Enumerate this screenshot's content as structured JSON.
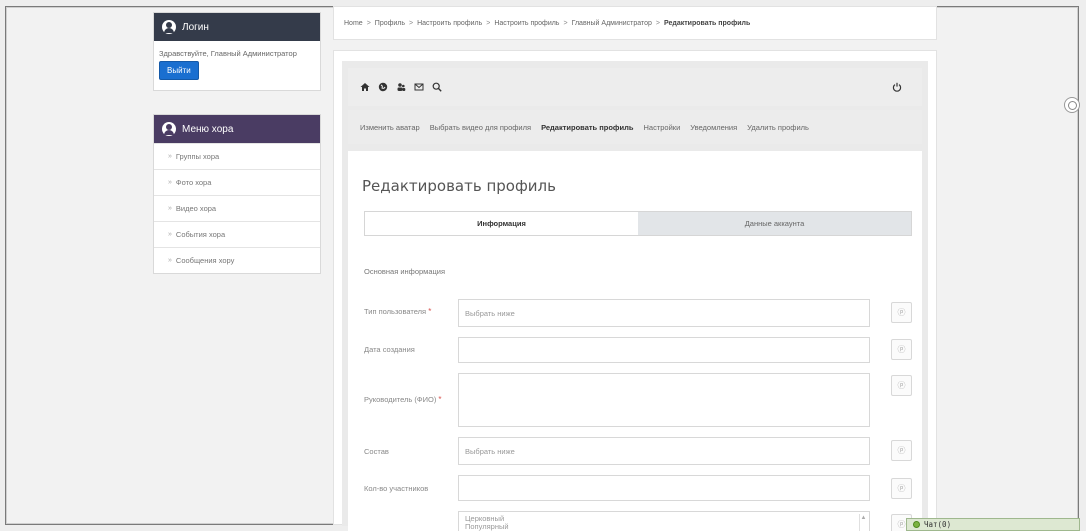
{
  "login_panel": {
    "title": "Логин",
    "greeting": "Здравствуйте, Главный Администратор",
    "logout_label": "Выйти"
  },
  "choir_menu": {
    "title": "Меню хора",
    "items": [
      {
        "label": "Группы хора"
      },
      {
        "label": "Фото хора"
      },
      {
        "label": "Видео хора"
      },
      {
        "label": "События хора"
      },
      {
        "label": "Сообщения хору"
      }
    ]
  },
  "breadcrumb": {
    "items": [
      "Home",
      "Профиль",
      "Настроить профиль",
      "Настроить профиль",
      "Главный Администратор"
    ],
    "current": "Редактировать профиль",
    "separator": ">"
  },
  "toolbar": {
    "icons": [
      "home-icon",
      "globe-icon",
      "users-icon",
      "envelope-icon",
      "search-icon"
    ],
    "power_icon": "power-icon"
  },
  "profile_tabs": [
    {
      "label": "Изменить аватар"
    },
    {
      "label": "Выбрать видео для профиля"
    },
    {
      "label": "Редактировать профиль"
    },
    {
      "label": "Настройки"
    },
    {
      "label": "Уведомления"
    },
    {
      "label": "Удалить профиль"
    }
  ],
  "active_tab": "Редактировать профиль",
  "form": {
    "title": "Редактировать профиль",
    "segments": [
      {
        "label": "Информация"
      },
      {
        "label": "Данные аккаунта"
      }
    ],
    "section_title": "Основная информация",
    "fields": [
      {
        "label": "Тип пользователя",
        "required": true,
        "placeholder": "Выбрать ниже",
        "value": ""
      },
      {
        "label": "Дата создания",
        "required": false,
        "placeholder": "",
        "value": ""
      },
      {
        "label": "Руководитель (ФИО)",
        "required": true,
        "placeholder": "",
        "value": ""
      },
      {
        "label": "Состав",
        "required": false,
        "placeholder": "Выбрать ниже",
        "value": ""
      },
      {
        "label": "Кол-во участников",
        "required": false,
        "placeholder": "",
        "value": ""
      }
    ],
    "list_options": [
      "Церковный",
      "Популярный"
    ]
  },
  "chat": {
    "label": "Чат(0)"
  },
  "colors": {
    "login_header": "#343b4a",
    "menu_header": "#4a3c63",
    "logout_button": "#1a6fd0",
    "required_marker": "#d9534f"
  }
}
